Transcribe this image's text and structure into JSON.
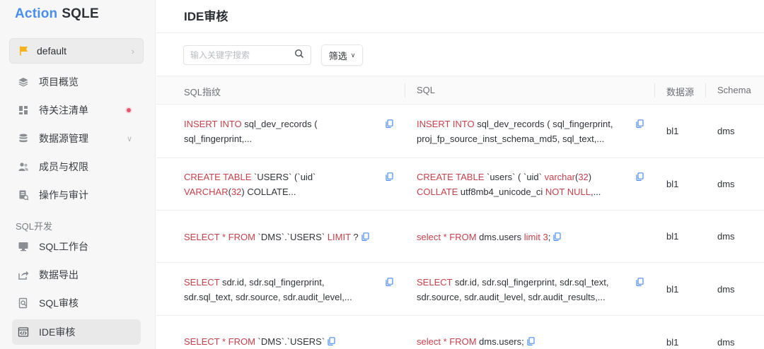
{
  "brand": {
    "part1": "Action",
    "part2": "SQLE"
  },
  "project": {
    "name": "default"
  },
  "nav": {
    "overview": "项目概览",
    "watchlist": "待关注清单",
    "datasource": "数据源管理",
    "members": "成员与权限",
    "audit": "操作与审计",
    "group_sql": "SQL开发",
    "workbench": "SQL工作台",
    "export": "数据导出",
    "sql_audit": "SQL审核",
    "ide_audit": "IDE审核"
  },
  "page": {
    "title": "IDE审核"
  },
  "toolbar": {
    "search_placeholder": "输入关键字搜索",
    "filter_label": "筛选"
  },
  "table": {
    "headers": [
      "SQL指纹",
      "SQL",
      "数据源",
      "Schema"
    ],
    "rows": [
      {
        "fp": [
          "INSERT INTO sql_dev_records (",
          "sql_fingerprint,..."
        ],
        "sql": [
          "INSERT INTO sql_dev_records ( sql_fingerprint,",
          "proj_fp_source_inst_schema_md5, sql_text,..."
        ],
        "source": "bl1",
        "schema": "dms"
      },
      {
        "fp": [
          "CREATE TABLE `USERS` (`uid`",
          "VARCHAR(32) COLLATE..."
        ],
        "sql": [
          "CREATE TABLE `users` ( `uid` varchar(32)",
          "COLLATE utf8mb4_unicode_ci NOT NULL,..."
        ],
        "source": "bl1",
        "schema": "dms"
      },
      {
        "fp": [
          "SELECT * FROM `DMS`.`USERS` LIMIT ?"
        ],
        "sql": [
          "select * FROM dms.users limit 3;"
        ],
        "source": "bl1",
        "schema": "dms"
      },
      {
        "fp": [
          "SELECT sdr.id, sdr.sql_fingerprint,",
          "sdr.sql_text, sdr.source, sdr.audit_level,..."
        ],
        "sql": [
          "SELECT sdr.id, sdr.sql_fingerprint, sdr.sql_text,",
          "sdr.source, sdr.audit_level, sdr.audit_results,..."
        ],
        "source": "bl1",
        "schema": "dms"
      },
      {
        "fp": [
          "SELECT * FROM `DMS`.`USERS`"
        ],
        "sql": [
          "select * FROM dms.users;"
        ],
        "source": "bl1",
        "schema": "dms"
      }
    ]
  },
  "colors": {
    "accent": "#4a8df0",
    "keyword": "#c4414b",
    "flag": "#f5b21a",
    "badge": "#e8566c"
  }
}
